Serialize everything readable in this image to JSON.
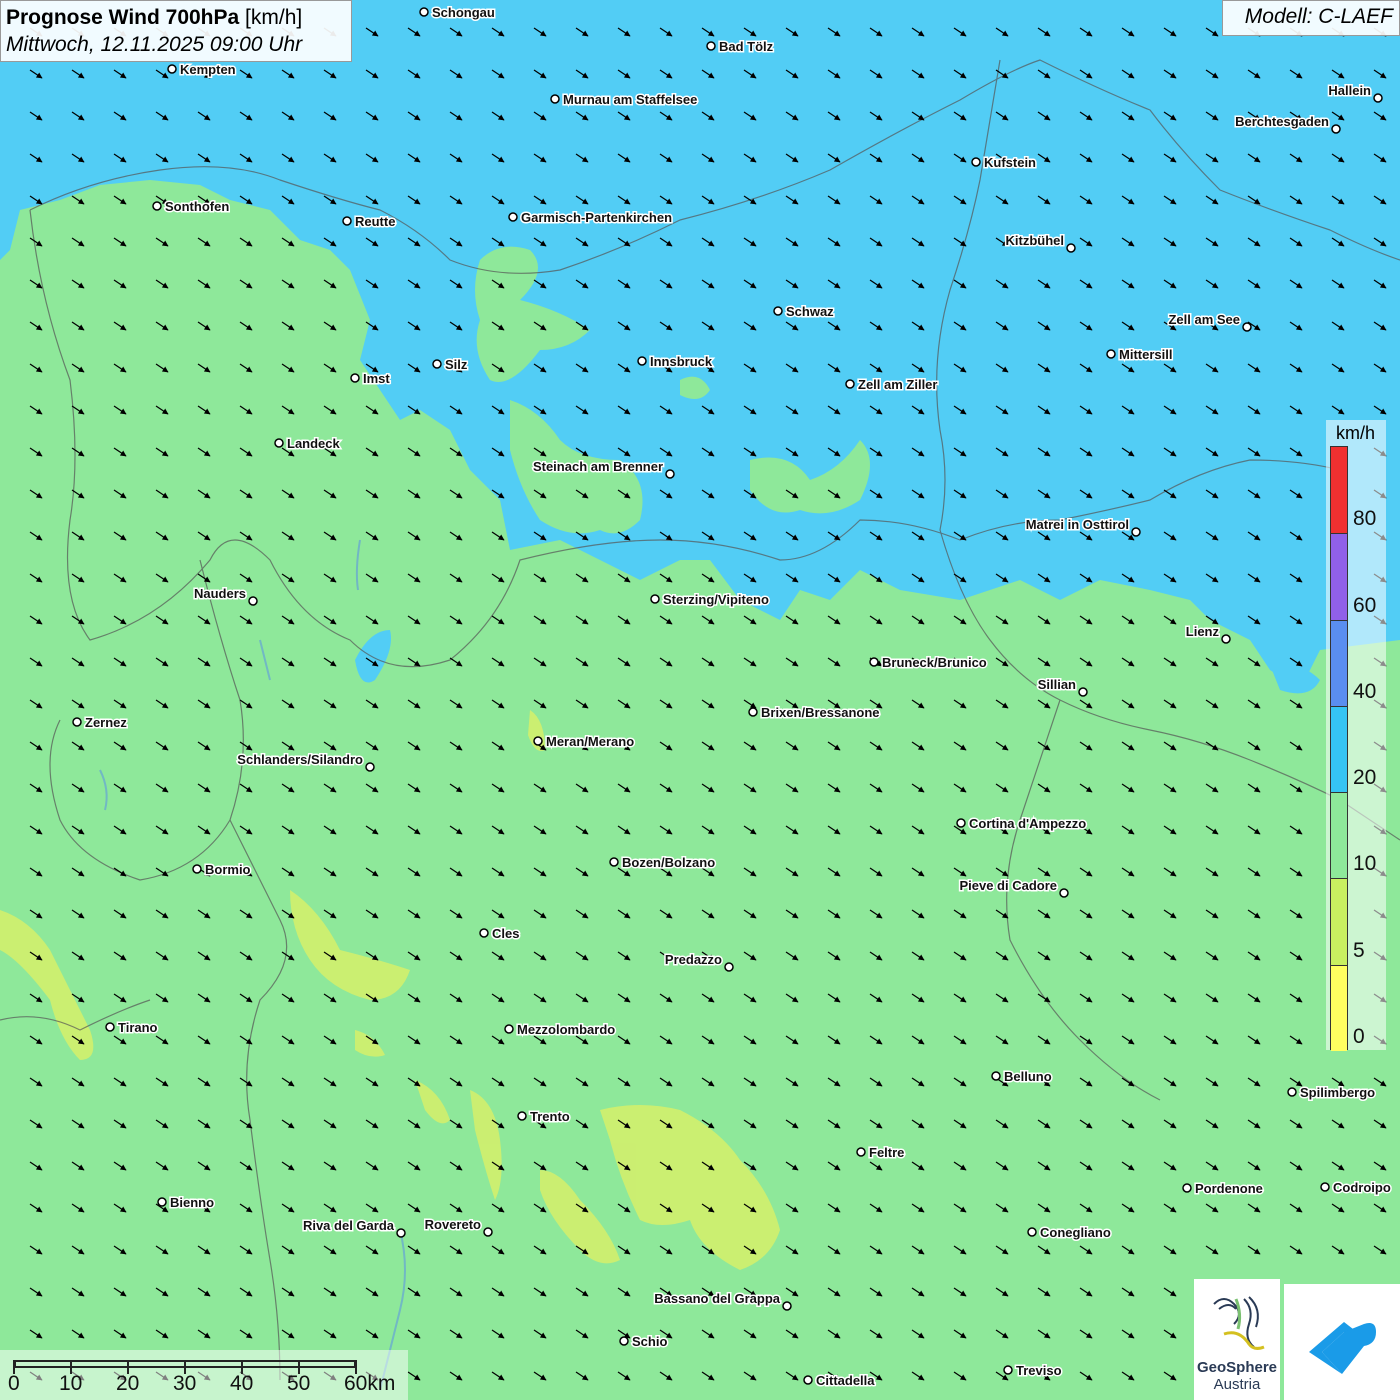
{
  "title": {
    "main": "Prognose Wind 700hPa",
    "unit": "[km/h]",
    "datetime": "Mittwoch, 12.11.2025 09:00 Uhr"
  },
  "model": "Modell: C-LAEF",
  "legend": {
    "unit": "km/h",
    "labels": [
      "80",
      "60",
      "40",
      "20",
      "10",
      "5",
      "0"
    ],
    "colors": [
      "#f03030",
      "#9060e8",
      "#5a8ef0",
      "#35c4f4",
      "#8ee89a",
      "#c8f060",
      "#ffff60"
    ]
  },
  "scale": {
    "labels": [
      "0",
      "10",
      "20",
      "30",
      "40",
      "50",
      "60km"
    ]
  },
  "cities": [
    {
      "name": "Schongau"
    },
    {
      "name": "Bad Tölz"
    },
    {
      "name": "Kempten"
    },
    {
      "name": "Murnau am Staffelsee"
    },
    {
      "name": "Hallein"
    },
    {
      "name": "Berchtesgaden"
    },
    {
      "name": "Kufstein"
    },
    {
      "name": "Sonthofen"
    },
    {
      "name": "Reutte"
    },
    {
      "name": "Garmisch-Partenkirchen"
    },
    {
      "name": "Kitzbühel"
    },
    {
      "name": "Schwaz"
    },
    {
      "name": "Zell am See"
    },
    {
      "name": "Mittersill"
    },
    {
      "name": "Innsbruck"
    },
    {
      "name": "Silz"
    },
    {
      "name": "Imst"
    },
    {
      "name": "Zell am Ziller"
    },
    {
      "name": "Landeck"
    },
    {
      "name": "Steinach am Brenner"
    },
    {
      "name": "Matrei in Osttirol"
    },
    {
      "name": "Nauders"
    },
    {
      "name": "Sterzing/Vipiteno"
    },
    {
      "name": "Lienz"
    },
    {
      "name": "Bruneck/Brunico"
    },
    {
      "name": "Sillian"
    },
    {
      "name": "Zernez"
    },
    {
      "name": "Brixen/Bressanone"
    },
    {
      "name": "Meran/Merano"
    },
    {
      "name": "Schlanders/Silandro"
    },
    {
      "name": "Cortina d'Ampezzo"
    },
    {
      "name": "Bozen/Bolzano"
    },
    {
      "name": "Bormio"
    },
    {
      "name": "Pieve di Cadore"
    },
    {
      "name": "Cles"
    },
    {
      "name": "Predazzo"
    },
    {
      "name": "Tirano"
    },
    {
      "name": "Mezzolombardo"
    },
    {
      "name": "Belluno"
    },
    {
      "name": "Spilimbergo"
    },
    {
      "name": "Trento"
    },
    {
      "name": "Feltre"
    },
    {
      "name": "Pordenone"
    },
    {
      "name": "Codroipo"
    },
    {
      "name": "Bienno"
    },
    {
      "name": "Riva del Garda"
    },
    {
      "name": "Rovereto"
    },
    {
      "name": "Conegliano"
    },
    {
      "name": "Bassano del Grappa"
    },
    {
      "name": "Schio"
    },
    {
      "name": "Treviso"
    },
    {
      "name": "Cittadella"
    }
  ],
  "logo": {
    "line1": "GeoSphere",
    "line2": "Austria"
  },
  "icons": {
    "wind_arrow": "wind-arrow-icon",
    "city_marker": "city-marker-icon"
  }
}
